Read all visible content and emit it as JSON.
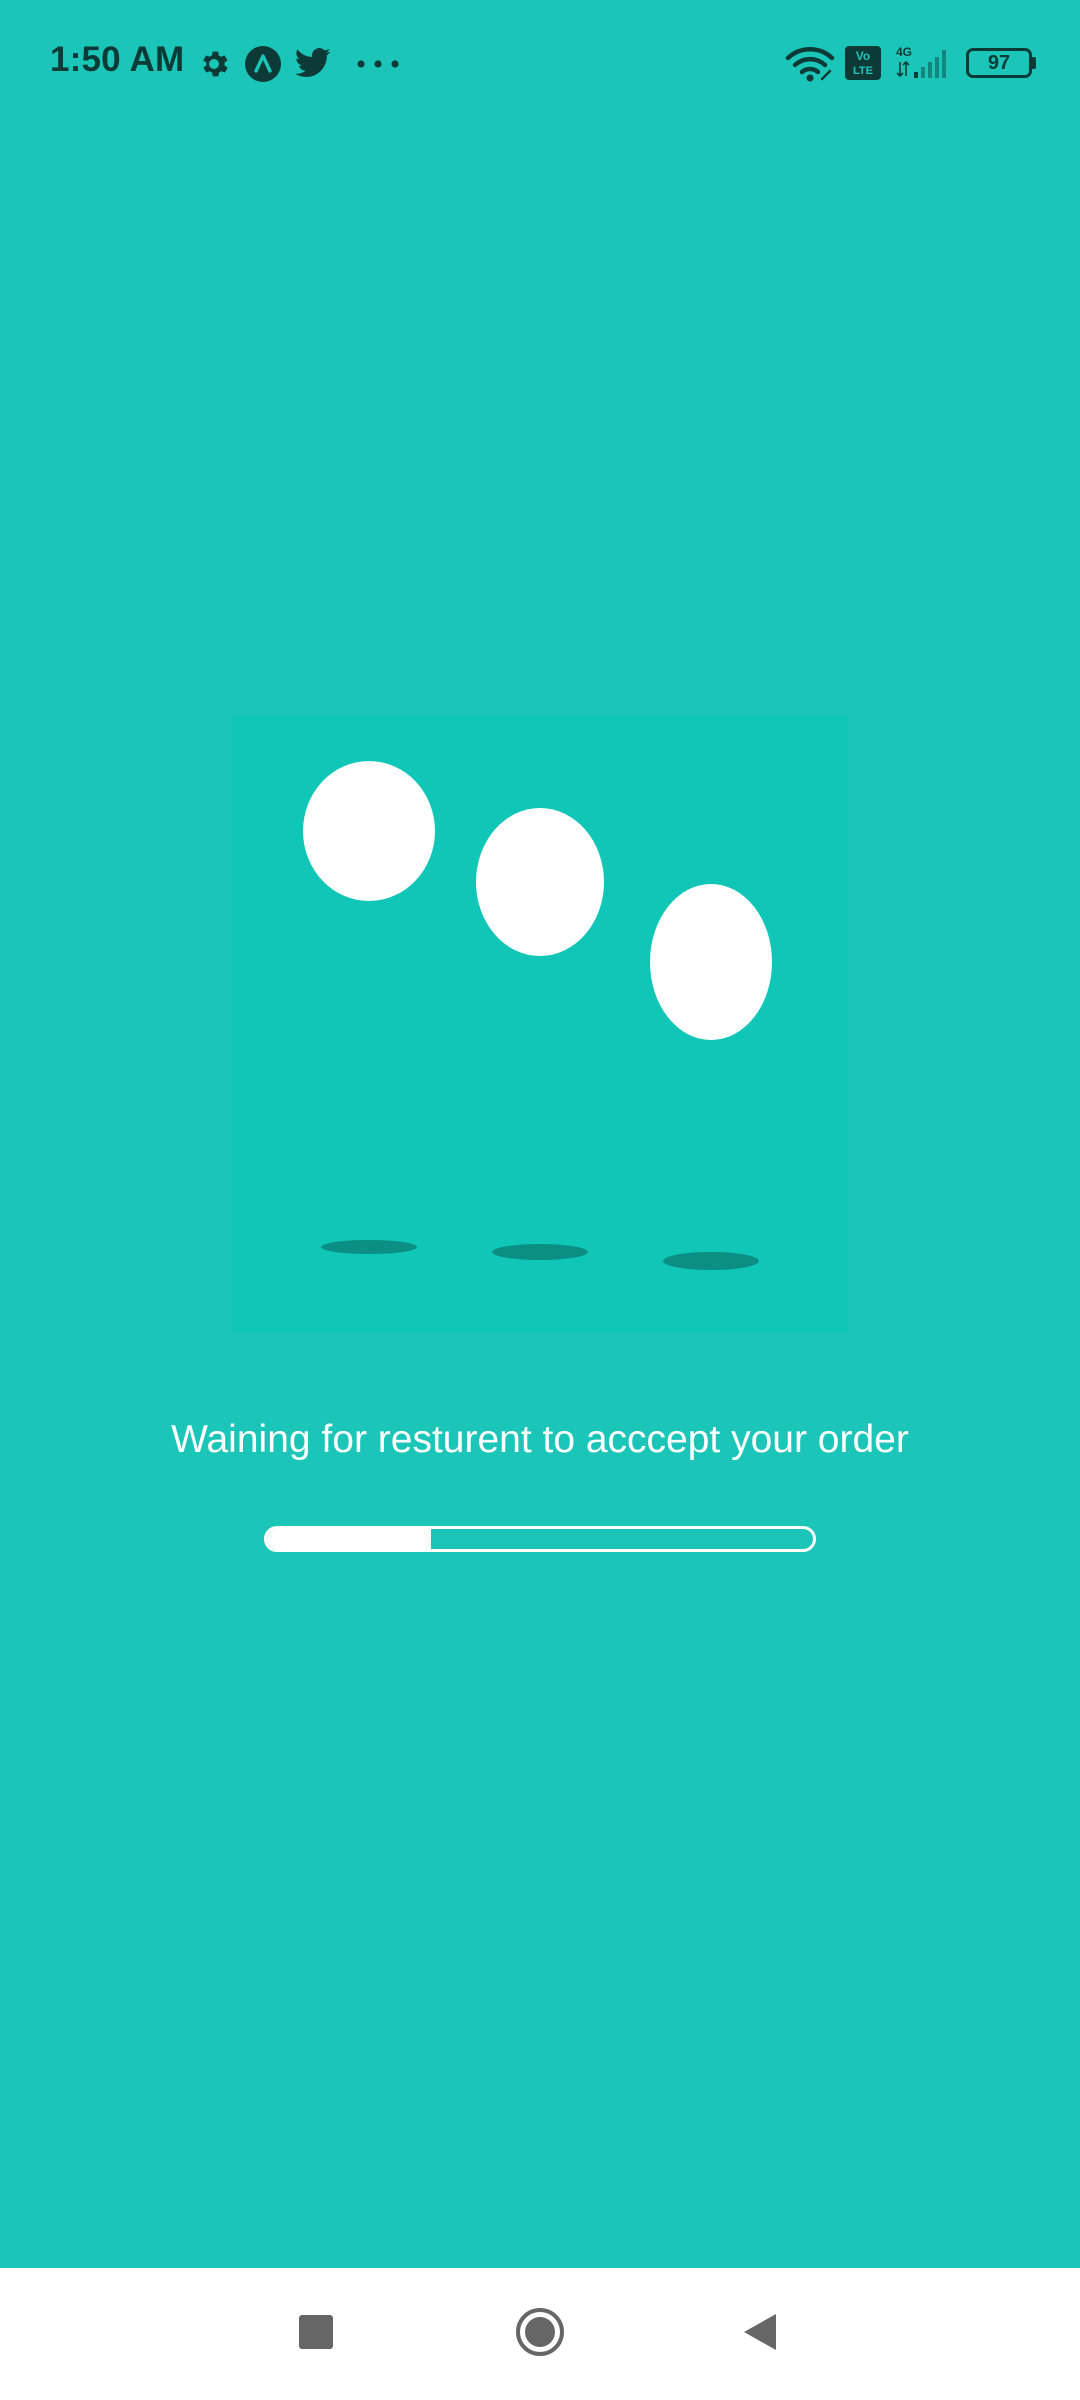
{
  "status_bar": {
    "time": "1:50 AM",
    "left_icons": [
      "gear-icon",
      "app-arrow-icon",
      "twitter-icon",
      "more-dots-icon"
    ],
    "right_icons": [
      "wifi-icon",
      "volte-icon",
      "signal-4g-icon",
      "battery-icon"
    ],
    "volte_label": "Vo LTE",
    "network_label": "4G",
    "battery_level": "97"
  },
  "main": {
    "message": "Waining for resturent to acccept your order",
    "progress": 0.3
  },
  "nav_bar": {
    "buttons": [
      "recents-square-icon",
      "home-circle-icon",
      "back-triangle-icon"
    ]
  },
  "colors": {
    "background": "#1bc6b9",
    "animation_box": "#10c6b6",
    "status_text": "#0c3a37",
    "nav_background": "#ffffff",
    "nav_icons": "#666666"
  }
}
